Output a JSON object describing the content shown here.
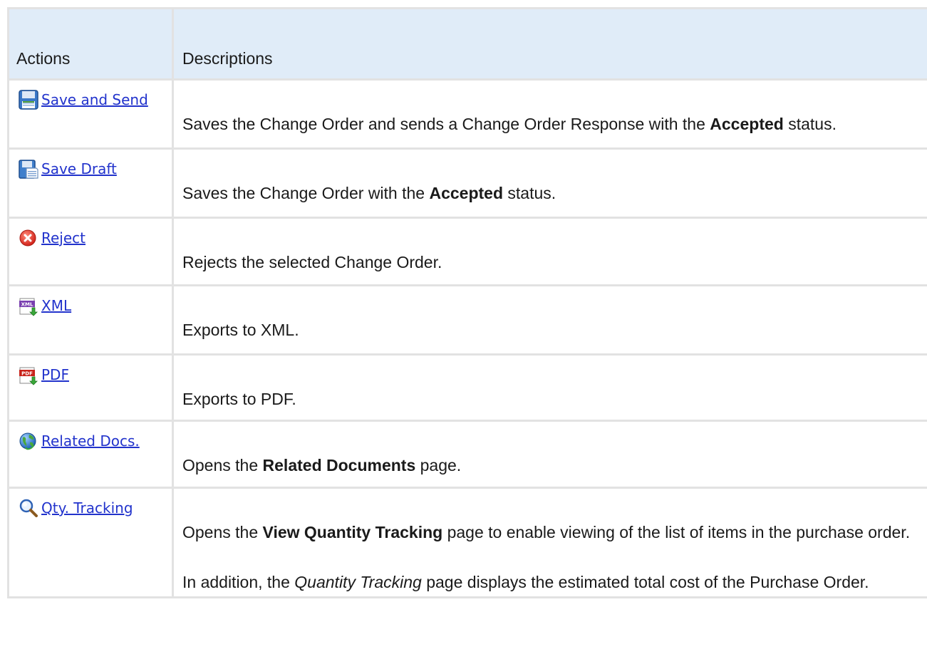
{
  "table": {
    "headers": {
      "actions": "Actions",
      "descriptions": "Descriptions"
    },
    "rows": [
      {
        "icon": "save-disk-icon",
        "label": "Save and Send",
        "desc": {
          "pre": "Saves the Change Order and sends a Change Order Response with the ",
          "bold": "Accepted",
          "post": " status."
        }
      },
      {
        "icon": "save-draft-icon",
        "label": "Save Draft",
        "desc": {
          "pre": "Saves the Change Order with the ",
          "bold": "Accepted",
          "post": " status."
        }
      },
      {
        "icon": "reject-icon",
        "label": "Reject",
        "desc": {
          "text": "Rejects the selected Change Order."
        }
      },
      {
        "icon": "xml-export-icon",
        "label": "XML",
        "desc": {
          "text": "Exports to XML."
        }
      },
      {
        "icon": "pdf-export-icon",
        "label": "PDF",
        "desc": {
          "text": "Exports to PDF."
        }
      },
      {
        "icon": "globe-icon",
        "label": "Related Docs.",
        "desc": {
          "pre": "Opens the ",
          "bold": "Related Documents",
          "post": " page."
        }
      },
      {
        "icon": "magnifier-icon",
        "label": "Qty. Tracking",
        "desc": {
          "p1_pre": "Opens the ",
          "p1_bold": "View Quantity Tracking",
          "p1_post": " page to enable viewing of the list of items in the purchase order.",
          "p2_pre": "In addition, the ",
          "p2_italic": "Quantity Tracking",
          "p2_post": " page displays the estimated total cost of the Purchase Order."
        }
      }
    ]
  }
}
